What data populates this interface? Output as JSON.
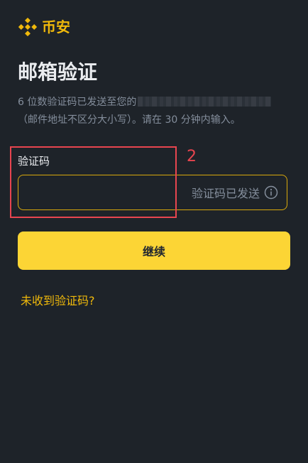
{
  "brand": {
    "name": "币安",
    "logo_icon": "binance-diamond-icon",
    "color": "#f0b90b"
  },
  "page": {
    "title": "邮箱验证",
    "description_line1": "6 位数验证码已发送至您的",
    "description_line2": "（邮件地址不区分大小写）。请在 30 分钟内输入。"
  },
  "form": {
    "code_label": "验证码",
    "code_value": "",
    "sent_status": "验证码已发送",
    "info_icon": "info-circle-icon",
    "continue_label": "继续",
    "resend_link": "未收到验证码?"
  },
  "annotation": {
    "number": "2",
    "color": "#e8454f"
  },
  "colors": {
    "background": "#1e2329",
    "accent": "#fcd535",
    "muted_text": "#848e9c"
  }
}
